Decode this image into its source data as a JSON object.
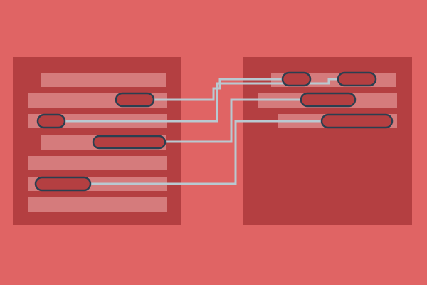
{
  "colors": {
    "background": "#E06464",
    "panel": "#B43F41",
    "row": "#D57B7C",
    "connector": "#B9C9D1",
    "pill_fill": "#B43F41",
    "pill_stroke": "#2A3F50"
  },
  "left_panel": {
    "rows": 7
  },
  "right_panel": {
    "rows": 3
  },
  "connections": [
    {
      "from": "left-row-2-pill",
      "to": "right-row-1-pill-a"
    },
    {
      "from": "left-row-3-pill",
      "to": "right-row-1-pill-b"
    },
    {
      "from": "left-row-4-pill",
      "to": "right-row-2-pill"
    },
    {
      "from": "left-row-6-pill",
      "to": "right-row-3-pill"
    }
  ]
}
